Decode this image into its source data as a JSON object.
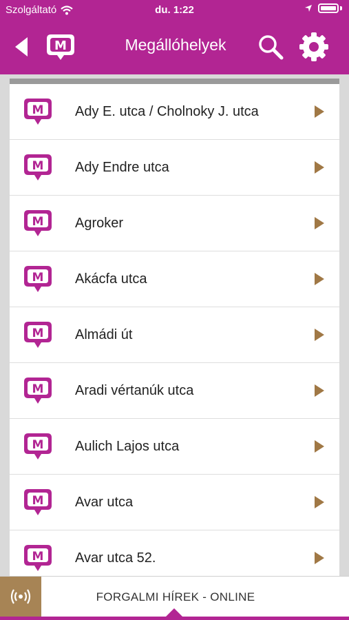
{
  "status_bar": {
    "carrier": "Szolgáltató",
    "time": "du. 1:22"
  },
  "nav": {
    "title": "Megállóhelyek",
    "logo_letter": "M"
  },
  "stops": [
    {
      "label": "Ady E. utca / Cholnoky J. utca"
    },
    {
      "label": "Ady Endre utca"
    },
    {
      "label": "Agroker"
    },
    {
      "label": "Akácfa utca"
    },
    {
      "label": "Almádi út"
    },
    {
      "label": "Aradi vértanúk utca"
    },
    {
      "label": "Aulich Lajos utca"
    },
    {
      "label": "Avar utca"
    },
    {
      "label": "Avar utca 52."
    }
  ],
  "bottom": {
    "news_label": "FORGALMI HÍREK - ONLINE"
  },
  "colors": {
    "brand": "#b22593",
    "accent": "#a07845"
  },
  "icons": {
    "stop": "stop-marker-icon",
    "arrow": "chevron-right-icon"
  }
}
